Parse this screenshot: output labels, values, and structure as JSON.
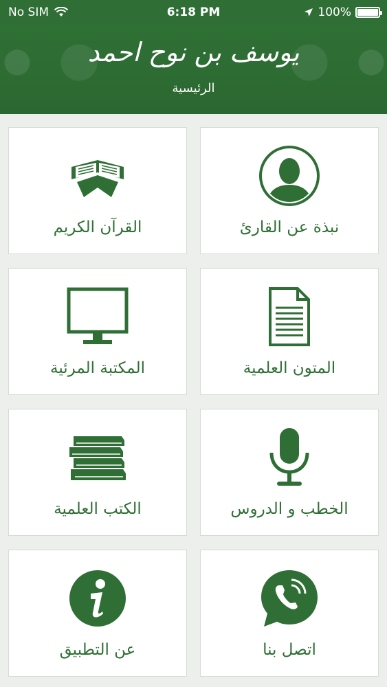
{
  "status_bar": {
    "carrier": "No SIM",
    "time": "6:18 PM",
    "battery": "100%",
    "battery_level": 1.0
  },
  "header": {
    "logo_text": "يوسف بن نوح احمد",
    "title": "الرئيسية"
  },
  "colors": {
    "brand_green": "#2f6f35",
    "tile_bg": "#ffffff",
    "page_bg": "#ecefec"
  },
  "tiles": [
    {
      "label": "نبذة عن القارئ",
      "icon": "person-icon"
    },
    {
      "label": "القرآن الكريم",
      "icon": "quran-icon"
    },
    {
      "label": "المتون العلمية",
      "icon": "document-icon"
    },
    {
      "label": "المكتبة المرئية",
      "icon": "monitor-icon"
    },
    {
      "label": "الخطب و الدروس",
      "icon": "microphone-icon"
    },
    {
      "label": "الكتب العلمية",
      "icon": "books-icon"
    },
    {
      "label": "اتصل بنا",
      "icon": "phone-chat-icon"
    },
    {
      "label": "عن التطبيق",
      "icon": "info-icon"
    }
  ]
}
